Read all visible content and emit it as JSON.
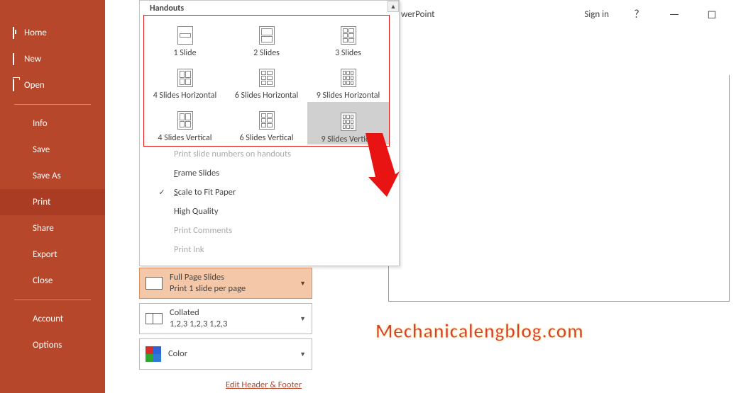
{
  "titlebar": {
    "app": "werPoint",
    "signin": "Sign in",
    "help": "?",
    "min": "—",
    "max": "◻"
  },
  "sidebar": {
    "home": "Home",
    "new": "New",
    "open": "Open",
    "info": "Info",
    "save": "Save",
    "saveas": "Save As",
    "print": "Print",
    "share": "Share",
    "export": "Export",
    "close": "Close",
    "account": "Account",
    "options": "Options"
  },
  "handouts": {
    "title": "Handouts",
    "s1": "1 Slide",
    "s2": "2 Slides",
    "s3": "3 Slides",
    "s4h": "4 Slides Horizontal",
    "s6h": "6 Slides Horizontal",
    "s9h": "9 Slides Horizontal",
    "s4v": "4 Slides Vertical",
    "s6v": "6 Slides Vertical",
    "s9v": "9 Slides Vertical"
  },
  "menu": {
    "printnum": "Print slide numbers on handouts",
    "frame_pre": "F",
    "frame_rest": "rame Slides",
    "scale_pre": "S",
    "scale_rest": "cale to Fit Paper",
    "hq": "High Quality",
    "printcomments": "Print Comments",
    "printink": "Print Ink"
  },
  "settings": {
    "fps_title": "Full Page Slides",
    "fps_sub": "Print 1 slide per page",
    "collated_title": "Collated",
    "collated_sub": "1,2,3    1,2,3    1,2,3",
    "color": "Color",
    "edit_hf": "Edit Header & Footer"
  },
  "watermark": "Mechanicalengblog.com"
}
